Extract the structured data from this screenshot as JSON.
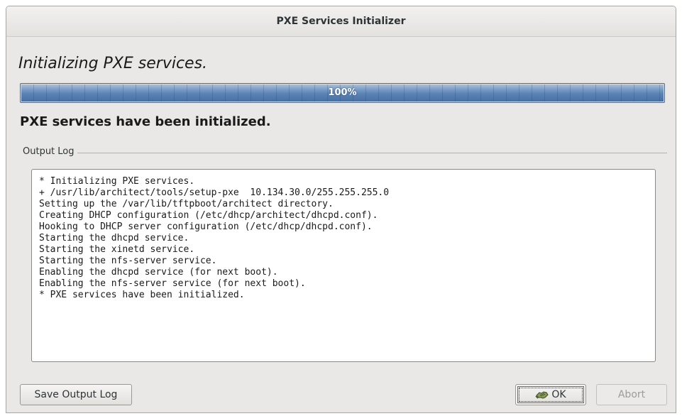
{
  "window": {
    "title": "PXE Services Initializer"
  },
  "heading": "Initializing PXE services.",
  "progress": {
    "percent": 100,
    "label": "100%"
  },
  "status": "PXE services have been initialized.",
  "output_log": {
    "label": "Output Log",
    "lines": [
      "* Initializing PXE services.",
      "+ /usr/lib/architect/tools/setup-pxe  10.134.30.0/255.255.255.0",
      "Setting up the /var/lib/tftpboot/architect directory.",
      "Creating DHCP configuration (/etc/dhcp/architect/dhcpd.conf).",
      "Hooking to DHCP server configuration (/etc/dhcp/dhcpd.conf).",
      "Starting the dhcpd service.",
      "Starting the xinetd service.",
      "Starting the nfs-server service.",
      "Enabling the dhcpd service (for next boot).",
      "Enabling the nfs-server service (for next boot).",
      "* PXE services have been initialized."
    ]
  },
  "buttons": {
    "save_log": "Save Output Log",
    "ok": "OK",
    "ok_icon": "handshake-icon",
    "abort": "Abort"
  },
  "colors": {
    "progress_fill": "#5a82b4",
    "window_bg": "#eae8e6",
    "disabled_text": "#9d9c9a"
  }
}
